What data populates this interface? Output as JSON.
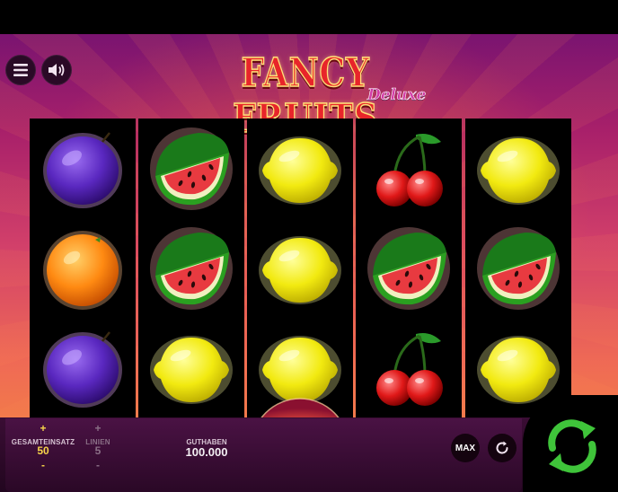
{
  "game": {
    "title": "FANCY FRUITS",
    "subtitle": "Deluxe"
  },
  "reels": [
    [
      "plum",
      "orange",
      "plum"
    ],
    [
      "watermelon",
      "watermelon",
      "lemon"
    ],
    [
      "lemon",
      "lemon",
      "lemon"
    ],
    [
      "cherry",
      "watermelon",
      "cherry"
    ],
    [
      "lemon",
      "watermelon",
      "lemon"
    ]
  ],
  "controls": {
    "menu_icon": "hamburger-menu-icon",
    "sound_icon": "speaker-icon",
    "stake_label": "GESAMTEINSATZ",
    "stake_value": "50",
    "lines_label": "LINIEN",
    "lines_value": "5",
    "plus": "+",
    "minus": "-",
    "balance_label": "GUTHABEN",
    "balance_value": "100.000",
    "max_label": "MAX",
    "autoplay_icon": "autoplay-icon",
    "spin_icon": "spin-arrows-icon"
  },
  "colors": {
    "accent_green": "#3fc43a",
    "value_yellow": "#f6d44a",
    "title_red": "#e8252a"
  }
}
